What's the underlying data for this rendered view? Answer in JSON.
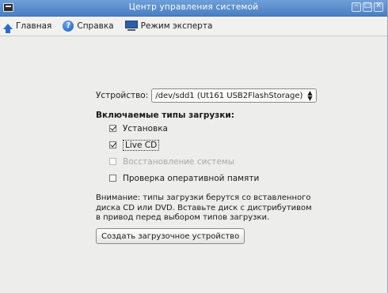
{
  "window": {
    "title": "Центр управления системой",
    "controls": [
      "minimize",
      "maximize",
      "close"
    ]
  },
  "toolbar": {
    "home_label": "Главная",
    "help_label": "Справка",
    "expert_label": "Режим эксперта",
    "home_icon": "home-arrow-icon",
    "help_icon": "help-icon",
    "expert_icon": "monitor-icon"
  },
  "device": {
    "label": "Устройство:",
    "selected": "/dev/sdd1 (Ut161 USB2FlashStorage)"
  },
  "boot_types": {
    "title": "Включаемые типы загрузки:",
    "options": [
      {
        "label": "Установка",
        "checked": true,
        "enabled": true
      },
      {
        "label": "Live CD",
        "checked": true,
        "enabled": true
      },
      {
        "label": "Восстановление системы",
        "checked": false,
        "enabled": false
      },
      {
        "label": "Проверка оперативной памяти",
        "checked": false,
        "enabled": true
      }
    ]
  },
  "note": "Внимание: типы загрузки берутся со вставленного диска CD или DVD. Вставьте диск с дистрибутивом в привод перед выбором типов загрузки.",
  "create_button": "Создать загрузочное устройство",
  "colors": {
    "titlebar": "#4a7fc3",
    "window_bg": "#ededeb"
  }
}
